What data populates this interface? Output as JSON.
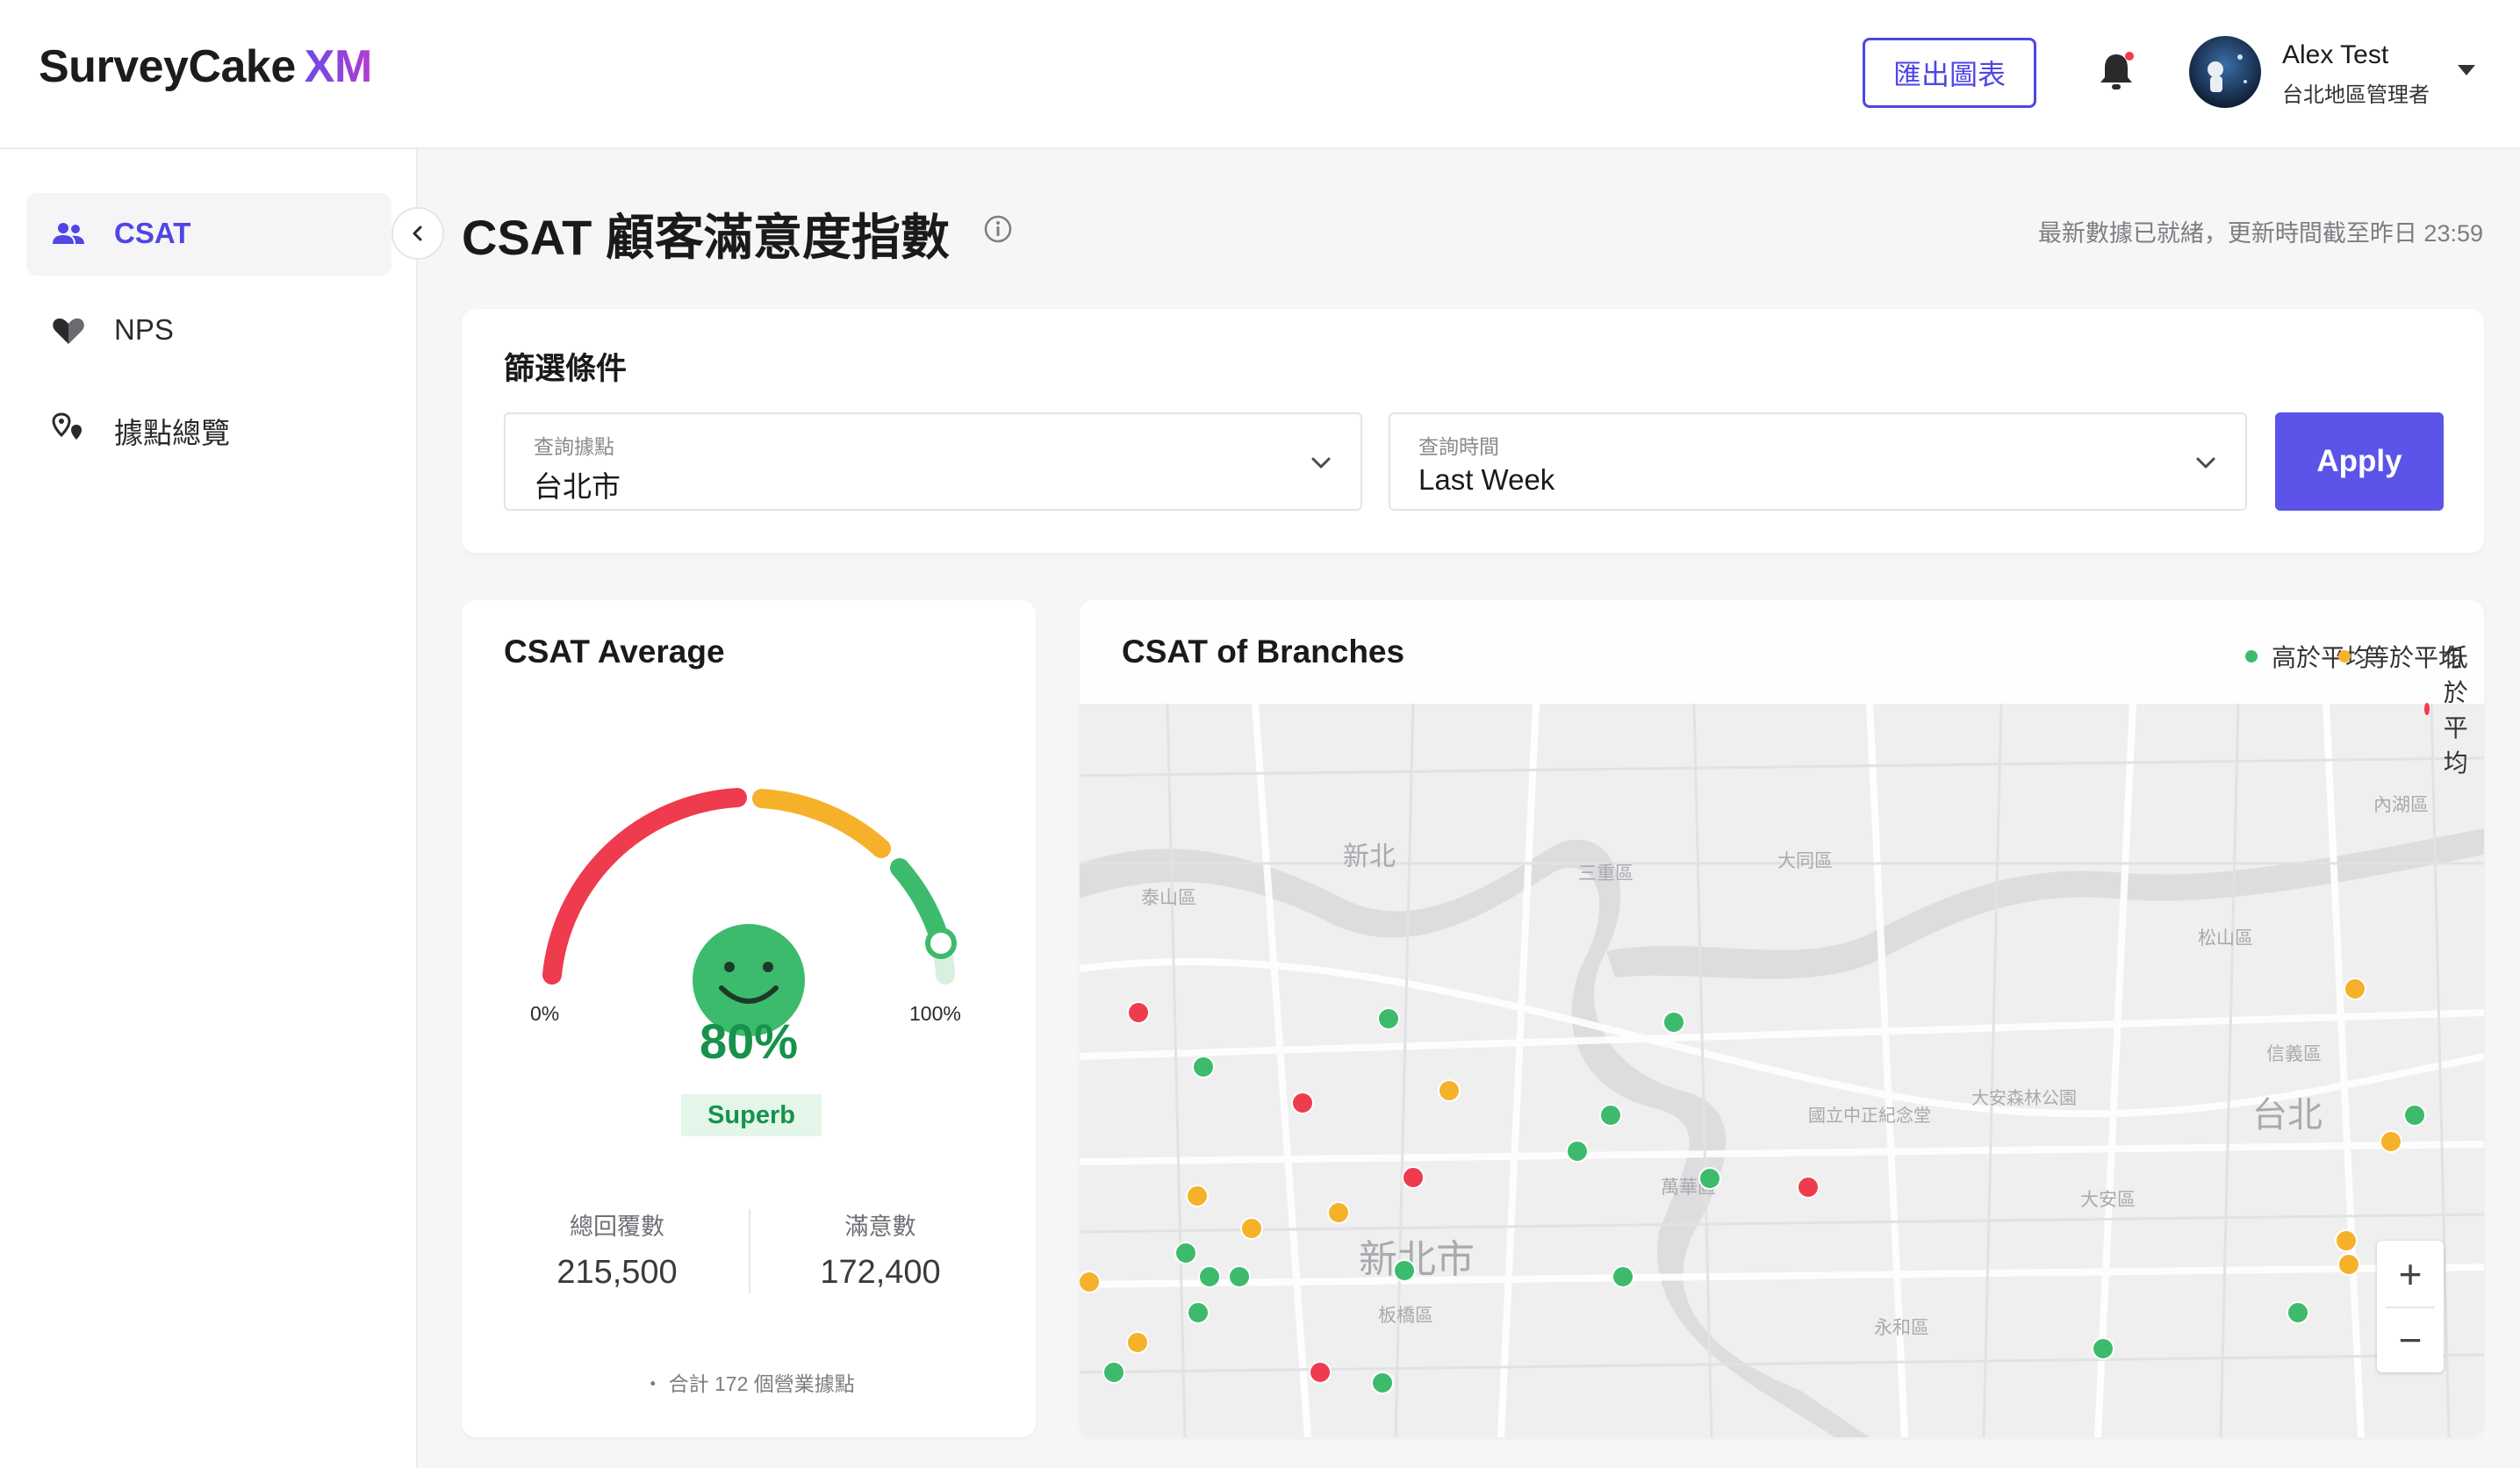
{
  "app": {
    "logo_main": "SurveyCake",
    "logo_suffix": "XM"
  },
  "header": {
    "export_label": "匯出圖表",
    "user_name": "Alex Test",
    "user_role": "台北地區管理者"
  },
  "sidebar": {
    "items": [
      {
        "label": "CSAT",
        "active": true,
        "icon": "users-icon"
      },
      {
        "label": "NPS",
        "active": false,
        "icon": "heart-icon"
      },
      {
        "label": "據點總覽",
        "active": false,
        "icon": "location-pins-icon"
      }
    ]
  },
  "page": {
    "title": "CSAT 顧客滿意度指數",
    "update_note": "最新數據已就緒，更新時間截至昨日 23:59"
  },
  "filters": {
    "title": "篩選條件",
    "location": {
      "label": "查詢據點",
      "value": "台北市"
    },
    "time": {
      "label": "查詢時間",
      "value": "Last Week"
    },
    "apply_label": "Apply"
  },
  "csat_average": {
    "title": "CSAT Average",
    "value_percent": 80,
    "value_text": "80%",
    "badge": "Superb",
    "min_label": "0%",
    "max_label": "100%",
    "total_responses_label": "總回覆數",
    "total_responses_value": "215,500",
    "satisfied_label": "滿意數",
    "satisfied_value": "172,400",
    "footnote": "・ 合計 172 個營業據點"
  },
  "branches": {
    "title": "CSAT of Branches",
    "legend": [
      {
        "label": "高於平均",
        "color": "#3dbb6c"
      },
      {
        "label": "等於平均",
        "color": "#f5b12a"
      },
      {
        "label": "低於平均",
        "color": "#ef3b4e"
      }
    ],
    "map_labels": {
      "xinbei": "新北",
      "xinbeishi": "新北市",
      "taipei": "台北",
      "datong": "大同區",
      "sanchong": "三重區",
      "songshan": "松山區",
      "taishan": "泰山區",
      "xinyi": "信義區",
      "daan": "大安區",
      "wanhua": "萬華區",
      "yonghe": "永和區",
      "banqiao": "板橋區",
      "neihu": "內湖區",
      "daan_park": "大安森林公園",
      "cks": "國立中正紀念堂"
    },
    "zoom_in": "+",
    "zoom_out": "−"
  },
  "colors": {
    "accent": "#4f46e5",
    "above": "#3dbb6c",
    "equal": "#f5b12a",
    "below": "#ef3b4e"
  }
}
